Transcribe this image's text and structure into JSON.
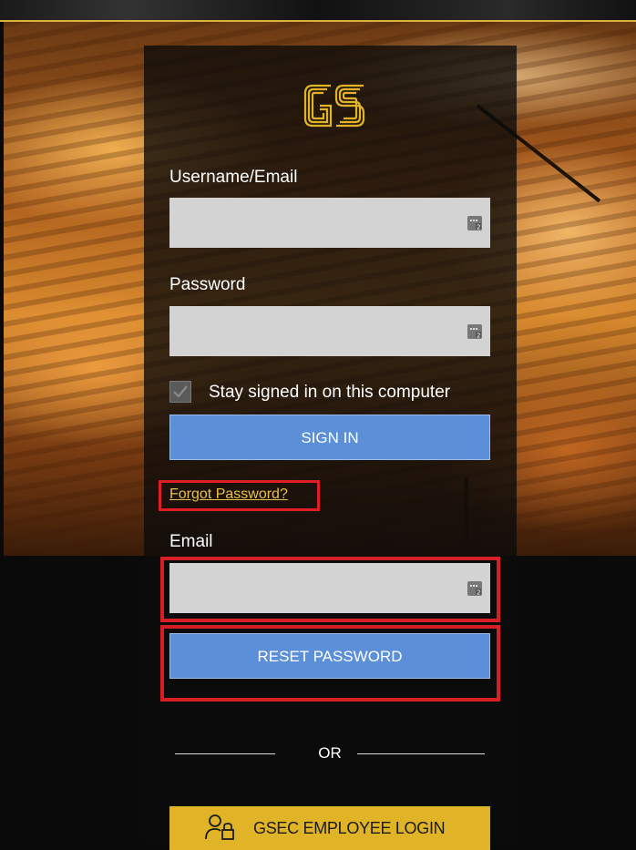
{
  "login": {
    "username_label": "Username/Email",
    "password_label": "Password",
    "stay_signed_in_label": "Stay signed in on this computer",
    "stay_signed_in_checked": true,
    "sign_in_label": "SIGN IN",
    "forgot_password_label": "Forgot Password?",
    "username_value": "",
    "password_value": ""
  },
  "reset": {
    "email_label": "Email",
    "email_value": "",
    "reset_button_label": "RESET PASSWORD"
  },
  "divider": {
    "or_label": "OR"
  },
  "employee": {
    "button_label": "GSEC EMPLOYEE LOGIN"
  },
  "brand": {
    "logo_text": "GS",
    "accent_color": "#e0b426",
    "highlight_color": "#d81e25",
    "button_color": "#5b8fd8"
  }
}
